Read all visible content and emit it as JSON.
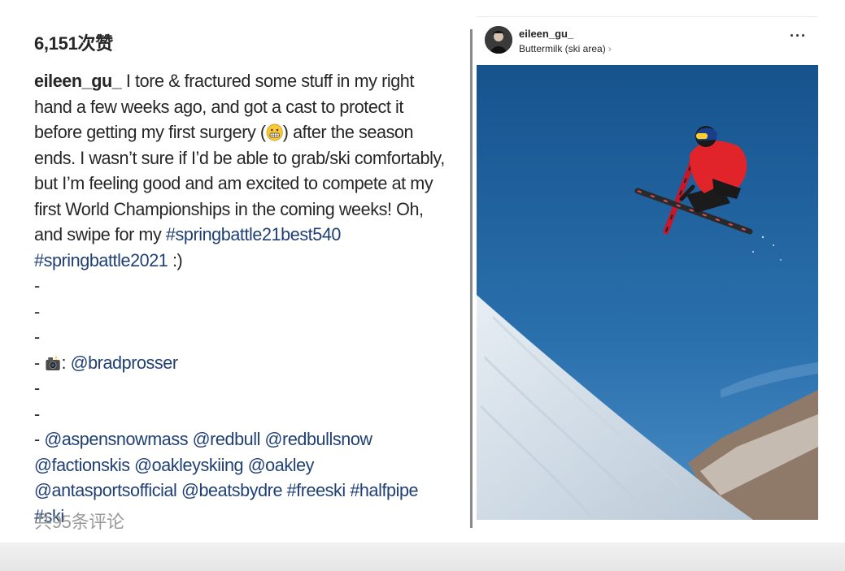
{
  "likes": "6,151次赞",
  "caption": {
    "username": "eileen_gu_",
    "line1_text": " I tore & fractured some stuff in my right hand a few weeks ago, and got a cast to protect it before getting my first surgery (",
    "emoji_grimace": "grimacing-face-emoji",
    "line2_text": ") after the season ends. I wasn’t sure if I’d be able to grab/ski comfortably, but I’m feeling good and am excited to compete at my first World Championships in the coming weeks! Oh, and swipe for my ",
    "hashtag1": "#springbattle21best540",
    "hashtag2": "#springbattle2021",
    "smile": " :)",
    "dash": "-",
    "camera_emoji": "camera-with-flash-emoji",
    "credit_colon": ": ",
    "credit_handle": "@bradprosser",
    "tags_line": "@aspensnowmass @redbull @redbullsnow @factionskis @oakleyskiing @oakley @antasportsofficial @beatsbydre #freeski #halfpipe #ski"
  },
  "comments_count": "共95条评论",
  "post": {
    "username": "eileen_gu_",
    "location": "Buttermilk (ski area)",
    "location_chevron": "›",
    "more_icon": "more-horizontal-icon",
    "more_label": "···"
  },
  "colors": {
    "text": "#262626",
    "link": "#1f3f75",
    "muted": "#9a9a9a",
    "sky": "#1f5f98",
    "jacket": "#e0242a"
  }
}
